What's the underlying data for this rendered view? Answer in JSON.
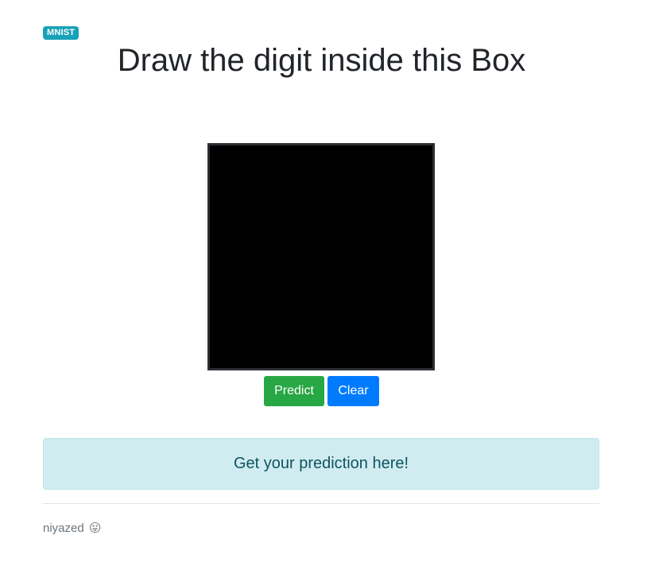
{
  "badge": "MNIST",
  "title": "Draw the digit inside this Box",
  "buttons": {
    "predict": "Predict",
    "clear": "Clear"
  },
  "prediction_alert": "Get your prediction here!",
  "footer": {
    "author": "niyazed",
    "emoji": "😛"
  },
  "colors": {
    "badge": "#17a2b8",
    "predict_button": "#28a745",
    "clear_button": "#007bff",
    "alert_background": "#d1ecf1",
    "alert_text": "#0c5460",
    "canvas_background": "#000000"
  }
}
